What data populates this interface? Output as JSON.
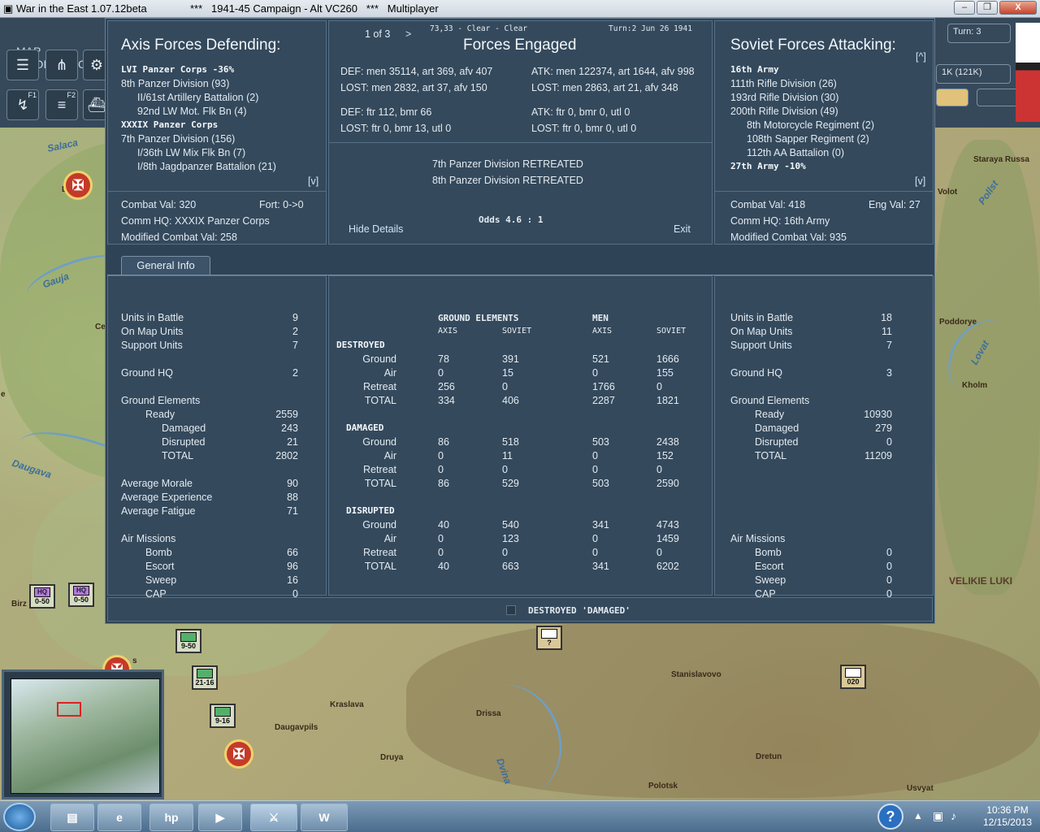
{
  "window": {
    "title_app": "War in the East 1.07.12beta",
    "title_campaign": "***   1941-45 Campaign - Alt VC260   ***   Multiplayer",
    "minimize": "‒",
    "restore": "❐",
    "close": "X"
  },
  "map_info_label": "MAP INFORMATIO",
  "toolbar": {
    "f1": "F1",
    "f2": "F2"
  },
  "right_strip": {
    "turn": "Turn: 3",
    "count": "1K (121K)"
  },
  "map_labels": {
    "salaca": "Salaca",
    "gauja": "Gauja",
    "daugava": "Daugava",
    "volot": "Volot",
    "staraya_russa": "Staraya Russa",
    "pollst": "Pollst",
    "poddorye": "Poddorye",
    "lovat": "Lovat",
    "kholm": "Kholm",
    "velikie_luki": "VELIKIE LUKI",
    "stanislavovo": "Stanislavovo",
    "kraslava": "Kraslava",
    "drissa": "Drissa",
    "daugavpils": "Daugavpils",
    "druya": "Druya",
    "dvina": "Dvina",
    "dretun": "Dretun",
    "polotsk": "Polotsk",
    "usvyat": "Usvyat",
    "birz": "Birz",
    "ce": "Ce",
    "e": "e",
    "l": "L",
    "s": "s"
  },
  "units": [
    {
      "label": "0-50",
      "kind": "hq"
    },
    {
      "label": "0-50",
      "kind": "hq"
    },
    {
      "label": "9-50",
      "kind": "inf"
    },
    {
      "label": "21-16",
      "kind": "inf"
    },
    {
      "label": "9-16",
      "kind": "inf"
    },
    {
      "label": "?",
      "kind": "inf"
    },
    {
      "label": "020",
      "kind": "inf"
    }
  ],
  "dialog": {
    "axis_title": "Axis Forces Defending:",
    "soviet_title": "Soviet Forces Attacking:",
    "center_title": "Forces Engaged",
    "page": "1 of 3",
    "next": ">",
    "hex_weather": "73,33 - Clear - Clear",
    "turn_date": "Turn:2  Jun 26 1941",
    "expand_axis": "[v]",
    "expand_soviet_top": "[^]",
    "expand_soviet": "[v]",
    "axis_units": [
      {
        "text": "LVI Panzer Corps  -36%",
        "bold": true,
        "indent": 0
      },
      {
        "text": "8th Panzer Division (93)",
        "bold": false,
        "indent": 0
      },
      {
        "text": "II/61st Artillery Battalion (2)",
        "bold": false,
        "indent": 1
      },
      {
        "text": "92nd LW Mot. Flk Bn (4)",
        "bold": false,
        "indent": 1
      },
      {
        "text": "XXXIX Panzer Corps",
        "bold": true,
        "indent": 0
      },
      {
        "text": "7th Panzer Division (156)",
        "bold": false,
        "indent": 0
      },
      {
        "text": "I/36th LW Mix Flk Bn (7)",
        "bold": false,
        "indent": 1
      },
      {
        "text": "I/8th Jagdpanzer Battalion (21)",
        "bold": false,
        "indent": 1
      }
    ],
    "soviet_units": [
      {
        "text": "16th Army",
        "bold": true,
        "indent": 0
      },
      {
        "text": "111th Rifle Division (26)",
        "bold": false,
        "indent": 0
      },
      {
        "text": "193rd Rifle Division (30)",
        "bold": false,
        "indent": 0
      },
      {
        "text": "200th Rifle Division (49)",
        "bold": false,
        "indent": 0
      },
      {
        "text": "8th Motorcycle Regiment (2)",
        "bold": false,
        "indent": 1
      },
      {
        "text": "108th Sapper Regiment (2)",
        "bold": false,
        "indent": 1
      },
      {
        "text": "112th AA Battalion (0)",
        "bold": false,
        "indent": 1
      },
      {
        "text": "27th Army  -10%",
        "bold": true,
        "indent": 0
      }
    ],
    "def_line1": "DEF: men 35114, art 369, afv 407",
    "lost_line1": "LOST: men 2832, art 37, afv 150",
    "def_line2": "DEF: ftr 112, bmr 66",
    "lost_line2": "LOST: ftr 0, bmr 13, utl 0",
    "atk_line1": "ATK: men 122374, art 1644, afv 998",
    "atk_lost1": "LOST: men 2863, art 21, afv 348",
    "atk_line2": "ATK: ftr 0, bmr 0, utl 0",
    "atk_lost2": "LOST: ftr 0, bmr 0, utl 0",
    "result1": "7th Panzer Division RETREATED",
    "result2": "8th Panzer Division RETREATED",
    "odds": "Odds 4.6 : 1",
    "hide_details": "Hide Details",
    "exit": "Exit",
    "axis_combat_val": "Combat Val: 320",
    "axis_fort": "Fort: 0->0",
    "axis_comm_hq": "Comm HQ: XXXIX Panzer Corps",
    "axis_mod_cv": "Modified Combat Val: 258",
    "soviet_combat_val": "Combat Val: 418",
    "soviet_eng": "Eng Val: 27",
    "soviet_comm_hq": "Comm HQ: 16th Army",
    "soviet_mod_cv": "Modified Combat Val: 935",
    "tab": "General Info",
    "footer": "DESTROYED 'DAMAGED'"
  },
  "axis_stats": [
    {
      "label": "Units in Battle",
      "value": "9",
      "indent": 0
    },
    {
      "label": "On Map Units",
      "value": "2",
      "indent": 0
    },
    {
      "label": "Support Units",
      "value": "7",
      "indent": 0
    },
    {
      "label": "Ground HQ",
      "value": "2",
      "indent": 0,
      "gap": true
    },
    {
      "label": "Ground Elements",
      "value": "",
      "indent": 0,
      "gap": true
    },
    {
      "label": "Ready",
      "value": "2559",
      "indent": 1
    },
    {
      "label": "Damaged",
      "value": "243",
      "indent": 2
    },
    {
      "label": "Disrupted",
      "value": "21",
      "indent": 2
    },
    {
      "label": "TOTAL",
      "value": "2802",
      "indent": 2
    },
    {
      "label": "Average Morale",
      "value": "90",
      "indent": 0,
      "gap": true
    },
    {
      "label": "Average Experience",
      "value": "88",
      "indent": 0
    },
    {
      "label": "Average Fatigue",
      "value": "71",
      "indent": 0
    },
    {
      "label": "Air Missions",
      "value": "",
      "indent": 0,
      "gap": true
    },
    {
      "label": "Bomb",
      "value": "66",
      "indent": 1
    },
    {
      "label": "Escort",
      "value": "96",
      "indent": 1
    },
    {
      "label": "Sweep",
      "value": "16",
      "indent": 1
    },
    {
      "label": "CAP",
      "value": "0",
      "indent": 1
    }
  ],
  "soviet_stats": [
    {
      "label": "Units in Battle",
      "value": "18",
      "indent": 0
    },
    {
      "label": "On Map Units",
      "value": "11",
      "indent": 0
    },
    {
      "label": "Support Units",
      "value": "7",
      "indent": 0
    },
    {
      "label": "Ground HQ",
      "value": "3",
      "indent": 0,
      "gap": true
    },
    {
      "label": "Ground Elements",
      "value": "",
      "indent": 0,
      "gap": true
    },
    {
      "label": "Ready",
      "value": "10930",
      "indent": 1
    },
    {
      "label": "Damaged",
      "value": "279",
      "indent": 1
    },
    {
      "label": "Disrupted",
      "value": "0",
      "indent": 1
    },
    {
      "label": "TOTAL",
      "value": "11209",
      "indent": 1
    },
    {
      "label": "Air Missions",
      "value": "",
      "indent": 0,
      "gap5": true
    },
    {
      "label": "Bomb",
      "value": "0",
      "indent": 1
    },
    {
      "label": "Escort",
      "value": "0",
      "indent": 1
    },
    {
      "label": "Sweep",
      "value": "0",
      "indent": 1
    },
    {
      "label": "CAP",
      "value": "0",
      "indent": 1
    }
  ],
  "losses": {
    "hdr_ground": "GROUND ELEMENTS",
    "hdr_men": "MEN",
    "hdr_axis": "AXIS",
    "hdr_soviet": "SOVIET",
    "sections": [
      {
        "title": "DESTROYED",
        "rows": [
          {
            "label": "Ground",
            "v": [
              "78",
              "391",
              "521",
              "1666"
            ]
          },
          {
            "label": "Air",
            "v": [
              "0",
              "15",
              "0",
              "155"
            ]
          },
          {
            "label": "Retreat",
            "v": [
              "256",
              "0",
              "1766",
              "0"
            ]
          },
          {
            "label": "TOTAL",
            "v": [
              "334",
              "406",
              "2287",
              "1821"
            ]
          }
        ]
      },
      {
        "title": "DAMAGED",
        "rows": [
          {
            "label": "Ground",
            "v": [
              "86",
              "518",
              "503",
              "2438"
            ]
          },
          {
            "label": "Air",
            "v": [
              "0",
              "11",
              "0",
              "152"
            ]
          },
          {
            "label": "Retreat",
            "v": [
              "0",
              "0",
              "0",
              "0"
            ]
          },
          {
            "label": "TOTAL",
            "v": [
              "86",
              "529",
              "503",
              "2590"
            ]
          }
        ]
      },
      {
        "title": "DISRUPTED",
        "rows": [
          {
            "label": "Ground",
            "v": [
              "40",
              "540",
              "341",
              "4743"
            ]
          },
          {
            "label": "Air",
            "v": [
              "0",
              "123",
              "0",
              "1459"
            ]
          },
          {
            "label": "Retreat",
            "v": [
              "0",
              "0",
              "0",
              "0"
            ]
          },
          {
            "label": "TOTAL",
            "v": [
              "40",
              "663",
              "341",
              "6202"
            ]
          }
        ]
      }
    ]
  },
  "taskbar": {
    "time": "10:36 PM",
    "date": "12/15/2013",
    "help": "?"
  }
}
